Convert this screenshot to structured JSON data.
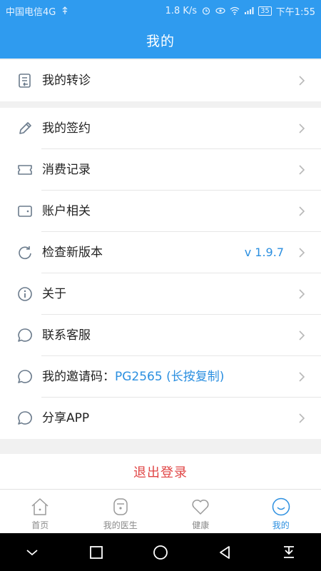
{
  "status_bar": {
    "carrier": "中国电信4G",
    "speed": "1.8 K/s",
    "battery": "35",
    "time": "下午1:55"
  },
  "header": {
    "title": "我的"
  },
  "groups": [
    [
      {
        "name": "my-referral",
        "icon": "document-icon",
        "label": "我的转诊"
      }
    ],
    [
      {
        "name": "my-contract",
        "icon": "pencil-icon",
        "label": "我的签约"
      },
      {
        "name": "spending-record",
        "icon": "ticket-icon",
        "label": "消费记录"
      },
      {
        "name": "account",
        "icon": "wallet-icon",
        "label": "账户相关"
      },
      {
        "name": "check-update",
        "icon": "refresh-icon",
        "label": "检查新版本",
        "value": "v 1.9.7"
      },
      {
        "name": "about",
        "icon": "info-icon",
        "label": "关于"
      },
      {
        "name": "contact-service",
        "icon": "chat-bubble-icon",
        "label": "联系客服"
      },
      {
        "name": "invite-code",
        "icon": "chat-bubble-icon",
        "label_prefix": "我的邀请码：",
        "label_code": "PG2565  (长按复制)"
      },
      {
        "name": "share-app",
        "icon": "chat-bubble-icon",
        "label": "分享APP"
      }
    ]
  ],
  "logout": {
    "label": "退出登录"
  },
  "tabs": [
    {
      "name": "home",
      "icon": "house-icon",
      "label": "首页",
      "active": false
    },
    {
      "name": "my-doctor",
      "icon": "doctor-badge-icon",
      "label": "我的医生",
      "active": false
    },
    {
      "name": "health",
      "icon": "heart-icon",
      "label": "健康",
      "active": false
    },
    {
      "name": "mine",
      "icon": "smiley-icon",
      "label": "我的",
      "active": true
    }
  ],
  "colors": {
    "accent": "#2f9bef",
    "link": "#2b8fe0",
    "danger": "#e04545"
  }
}
